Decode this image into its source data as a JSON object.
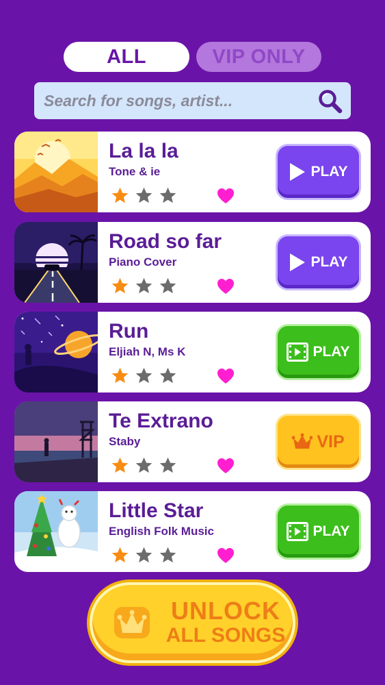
{
  "tabs": {
    "all": "ALL",
    "vip": "VIP ONLY"
  },
  "search": {
    "placeholder": "Search for songs, artist..."
  },
  "songs": [
    {
      "title": "La la la",
      "artist": "Tone & ie",
      "stars": 1,
      "button": "PLAY",
      "button_style": "purple"
    },
    {
      "title": "Road so far",
      "artist": "Piano Cover",
      "stars": 1,
      "button": "PLAY",
      "button_style": "purple"
    },
    {
      "title": "Run",
      "artist": "Eljiah N, Ms K",
      "stars": 1,
      "button": "PLAY",
      "button_style": "green-video"
    },
    {
      "title": "Te Extrano",
      "artist": "Staby",
      "stars": 1,
      "button": "VIP",
      "button_style": "gold-crown"
    },
    {
      "title": "Little Star",
      "artist": "English Folk Music",
      "stars": 1,
      "button": "PLAY",
      "button_style": "green-video"
    }
  ],
  "unlock": {
    "line1": "UNLOCK",
    "line2": "ALL SONGS"
  },
  "colors": {
    "background": "#6a13a8",
    "title_text": "#5a1d96",
    "star_active": "#f98c12",
    "star_inactive": "#6c6c6c",
    "heart": "#ff1fd0",
    "play_purple": "#7a44ee",
    "play_green": "#3cbe1c",
    "vip_gold": "#ffc21e"
  }
}
